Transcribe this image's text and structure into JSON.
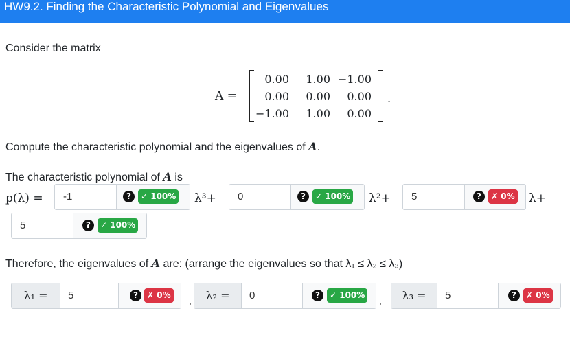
{
  "header": {
    "title": "HW9.2. Finding the Characteristic Polynomial and Eigenvalues"
  },
  "intro": {
    "consider": "Consider the matrix"
  },
  "matrix": {
    "lhs": "A =",
    "rows": [
      [
        "0.00",
        "1.00",
        "−1.00"
      ],
      [
        "0.00",
        "0.00",
        "0.00"
      ],
      [
        "−1.00",
        "1.00",
        "0.00"
      ]
    ],
    "end": "."
  },
  "compute_text": "Compute the characteristic polynomial and the eigenvalues of",
  "compute_var": "A",
  "compute_end": ".",
  "poly_text": "The characteristic polynomial of",
  "poly_var": "A",
  "poly_is": "is",
  "poly_lhs": "p(λ) =",
  "coeffs": [
    {
      "value": "-1",
      "badge": "✓ 100%",
      "status": "correct",
      "suffix": "λ³+"
    },
    {
      "value": "0",
      "badge": "✓ 100%",
      "status": "correct",
      "suffix": "λ²+"
    },
    {
      "value": "5",
      "badge": "✗ 0%",
      "status": "incorrect",
      "suffix": "λ+"
    },
    {
      "value": "5",
      "badge": "✓ 100%",
      "status": "correct",
      "suffix": ""
    }
  ],
  "eigen_text": "Therefore, the eigenvalues of",
  "eigen_var": "A",
  "eigen_rest": "are: (arrange the eigenvalues so that λ₁ ≤ λ₂ ≤ λ₃)",
  "eigen": [
    {
      "label": "λ₁ =",
      "value": "5",
      "badge": "✗ 0%",
      "status": "incorrect"
    },
    {
      "label": "λ₂ =",
      "value": "0",
      "badge": "✓ 100%",
      "status": "correct"
    },
    {
      "label": "λ₃ =",
      "value": "5",
      "badge": "✗ 0%",
      "status": "incorrect"
    }
  ],
  "separator": ",",
  "help_icon": "question-circle-icon",
  "colors": {
    "header": "#1e7ff0",
    "correct": "#28a745",
    "incorrect": "#dc3545"
  }
}
